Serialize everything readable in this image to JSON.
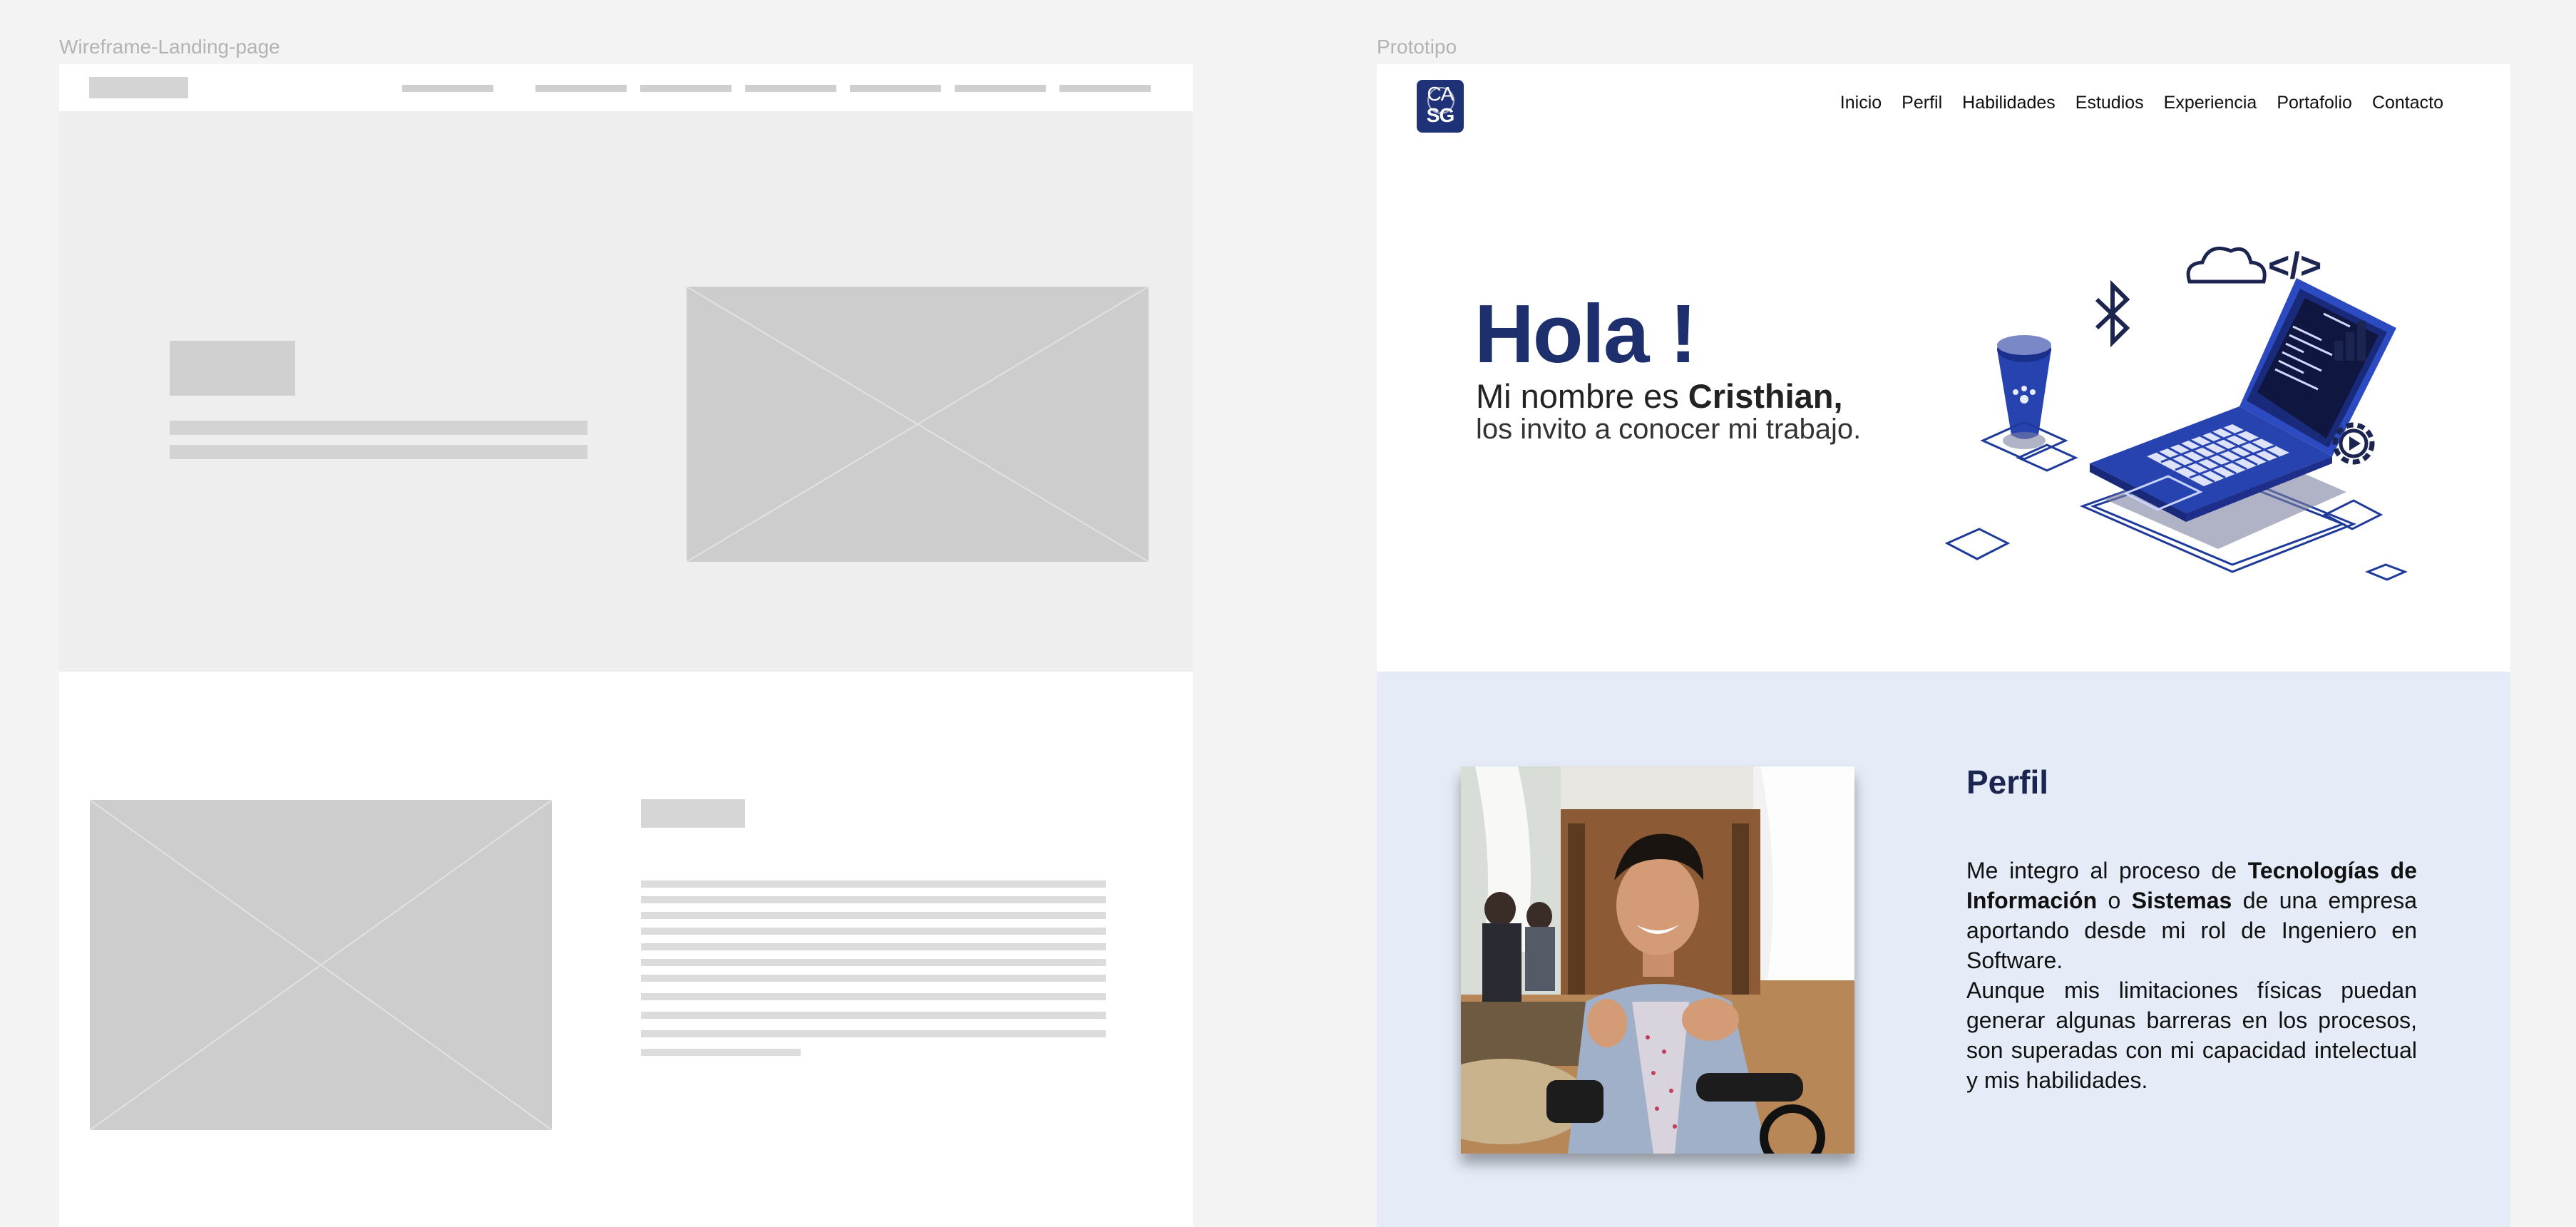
{
  "wireframe": {
    "label": "Wireframe-Landing-page"
  },
  "prototype": {
    "label": "Prototipo",
    "logo": {
      "line1": "CA",
      "line2": "SG"
    },
    "nav": [
      "Inicio",
      "Perfil",
      "Habilidades",
      "Estudios",
      "Experiencia",
      "Portafolio",
      "Contacto"
    ],
    "hero": {
      "greeting": "Hola !",
      "name_prefix": "Mi nombre es ",
      "name": "Cristhian,",
      "invite": "los invito a conocer mi trabajo."
    },
    "profile": {
      "title": "Perfil",
      "p1_a": "Me integro al proceso de ",
      "p1_b": "Tecnologías de Información",
      "p1_c": " o ",
      "p1_d": "Sistemas",
      "p1_e": " de una empresa aportando desde mi rol de Ingeniero en Software.",
      "p2": "Aunque mis limitaciones físicas puedan generar algunas barreras en los procesos, son superadas con mi capacidad intelectual y mis habilidades."
    },
    "colors": {
      "brand": "#1e2f6e",
      "profile_bg": "#e5ecf8"
    },
    "icons": [
      "bluetooth-icon",
      "cloud-icon",
      "code-icon",
      "bar-chart-icon",
      "gear-icon",
      "laptop-icon",
      "cup-icon"
    ]
  }
}
